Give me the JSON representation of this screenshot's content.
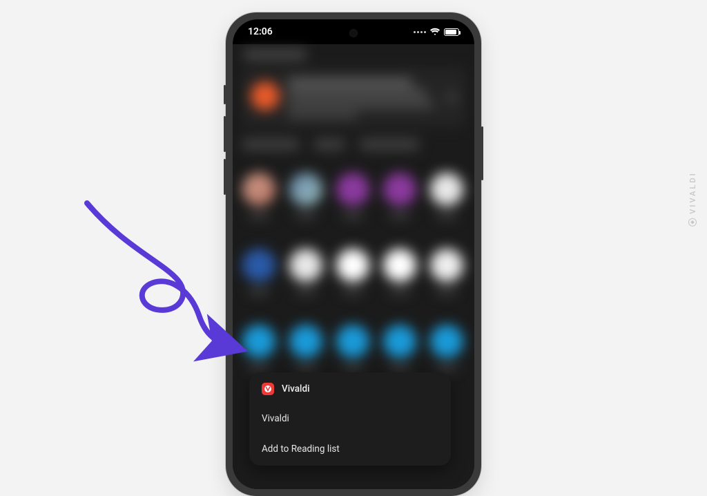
{
  "watermark": {
    "text": "VIVALDI"
  },
  "statusbar": {
    "time": "12:06"
  },
  "menu": {
    "header_label": "Vivaldi",
    "items": [
      {
        "label": "Vivaldi"
      },
      {
        "label": "Add to Reading list"
      }
    ]
  },
  "colors": {
    "accent_arrow": "#5a3ad6",
    "vivaldi_red": "#ef3939"
  }
}
